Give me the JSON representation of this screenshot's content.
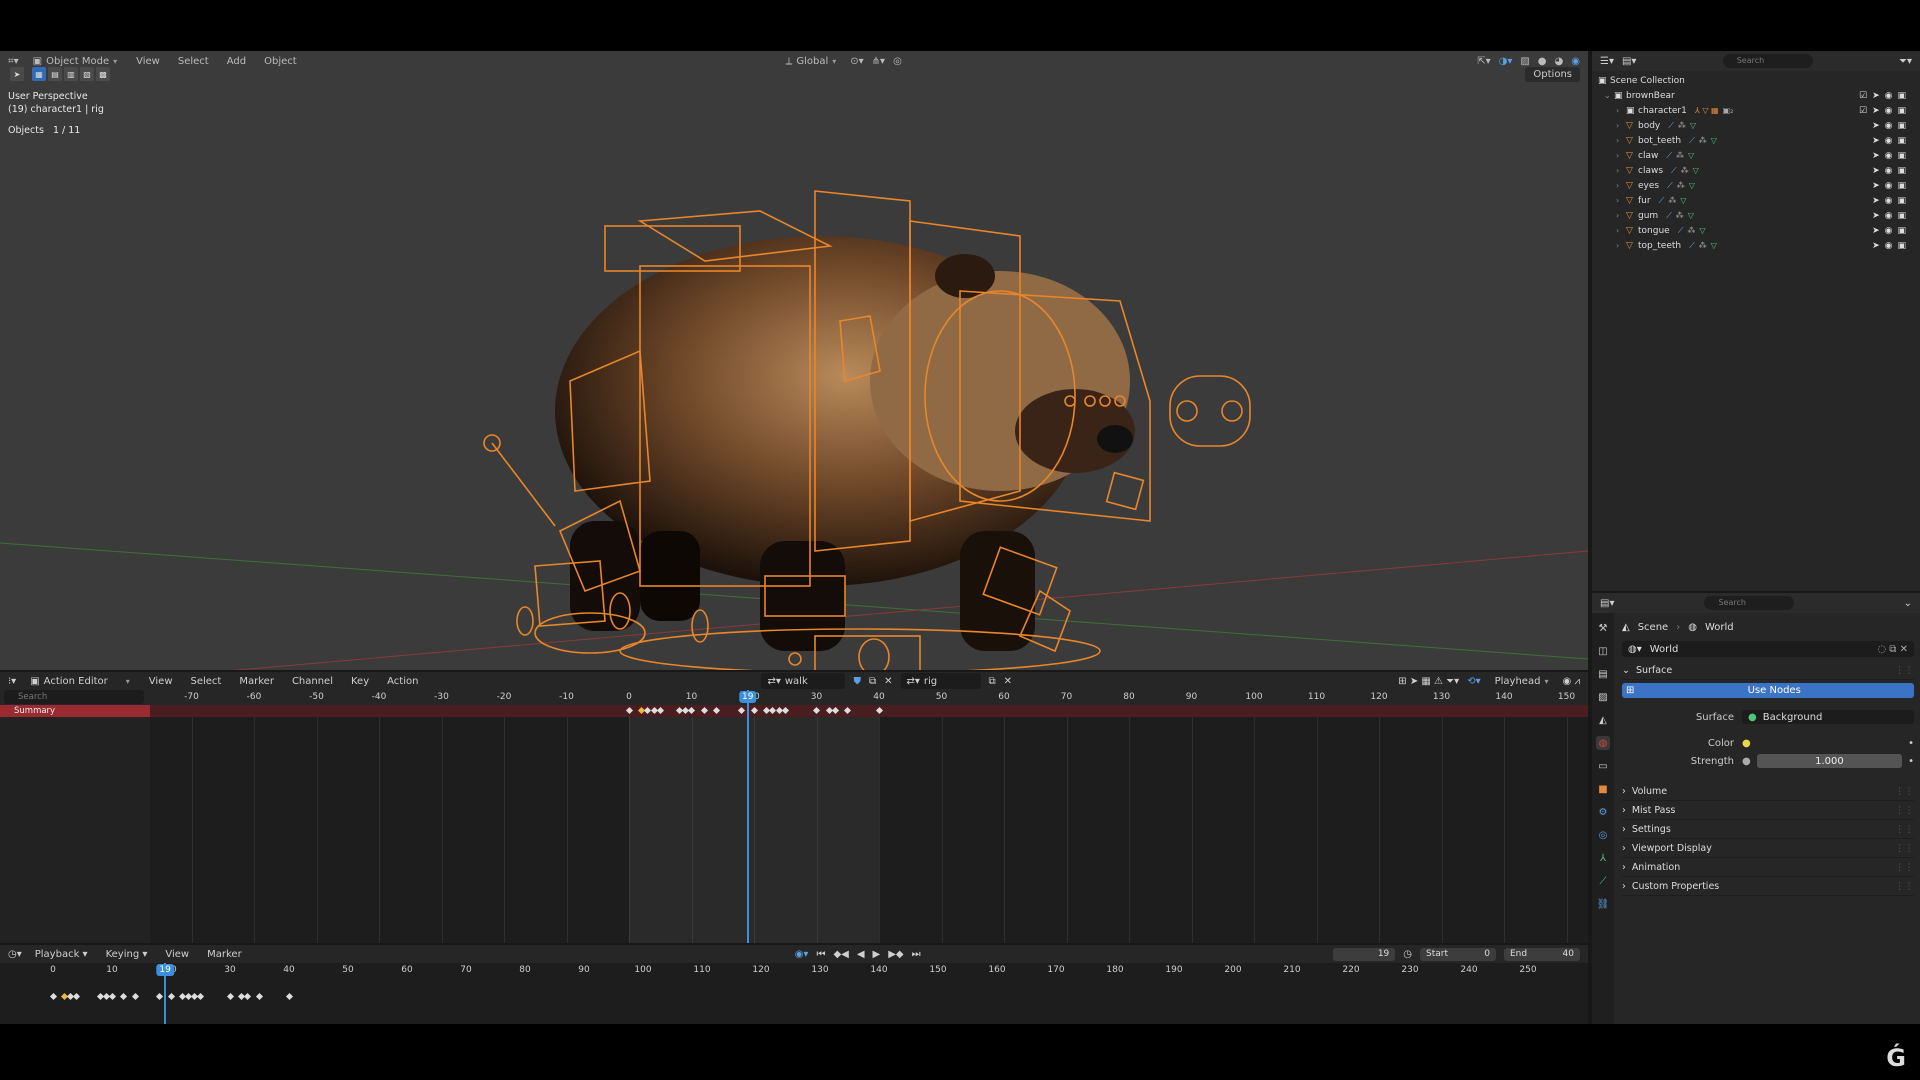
{
  "viewport": {
    "mode": "Object Mode",
    "menus": [
      "View",
      "Select",
      "Add",
      "Object"
    ],
    "transform_orientation": "Global",
    "options_label": "Options",
    "perspective": "User Perspective",
    "active_object": "(19) character1 | rig",
    "objects_label": "Objects",
    "objects_count": "1 / 11"
  },
  "outliner": {
    "search_placeholder": "Search",
    "scene_collection": "Scene Collection",
    "collection": "brownBear",
    "rows": [
      "character1",
      "body",
      "bot_teeth",
      "claw",
      "claws",
      "eyes",
      "fur",
      "gum",
      "tongue",
      "top_teeth"
    ]
  },
  "properties": {
    "search_placeholder": "Search",
    "breadcrumb": [
      "Scene",
      "World"
    ],
    "world_name": "World",
    "surface_panel": "Surface",
    "use_nodes": "Use Nodes",
    "surface_label": "Surface",
    "surface_value": "Background",
    "color_label": "Color",
    "strength_label": "Strength",
    "strength_value": "1.000",
    "panels": [
      "Volume",
      "Mist Pass",
      "Settings",
      "Viewport Display",
      "Animation",
      "Custom Properties"
    ]
  },
  "action_editor": {
    "editor_type": "Action Editor",
    "menus": [
      "View",
      "Select",
      "Marker",
      "Channel",
      "Key",
      "Action"
    ],
    "action_name": "walk",
    "slot_name": "rig",
    "playhead_mode": "Playhead",
    "search_placeholder": "Search",
    "summary_label": "Summary",
    "ruler": [
      -70,
      -60,
      -50,
      -40,
      -30,
      -20,
      -10,
      0,
      10,
      20,
      30,
      40,
      50,
      60,
      70,
      80,
      90,
      100,
      110,
      120,
      130,
      140,
      150
    ],
    "current_frame": "19",
    "keyframes": [
      0,
      2,
      3,
      4,
      5,
      8,
      9,
      10,
      12,
      14,
      18,
      20,
      22,
      23,
      24,
      25,
      30,
      32,
      33,
      35,
      40
    ],
    "selected_keyframes": [
      2
    ]
  },
  "timeline": {
    "menus": [
      "Playback",
      "Keying",
      "View",
      "Marker"
    ],
    "current_frame": "19",
    "start_label": "Start",
    "start_value": "0",
    "end_label": "End",
    "end_value": "40",
    "ruler": [
      0,
      10,
      20,
      30,
      40,
      50,
      60,
      70,
      80,
      90,
      100,
      110,
      120,
      130,
      140,
      150,
      160,
      170,
      180,
      190,
      200,
      210,
      220,
      230,
      240,
      250
    ],
    "keyframes": [
      0,
      2,
      3,
      4,
      8,
      9,
      10,
      12,
      14,
      18,
      20,
      22,
      23,
      24,
      25,
      30,
      32,
      33,
      35,
      40
    ],
    "selected_keyframes": [
      2
    ]
  },
  "colors": {
    "accent": "#3c8fdb",
    "rig_orange": "#e8862a",
    "summary_red": "#9a2a32"
  }
}
